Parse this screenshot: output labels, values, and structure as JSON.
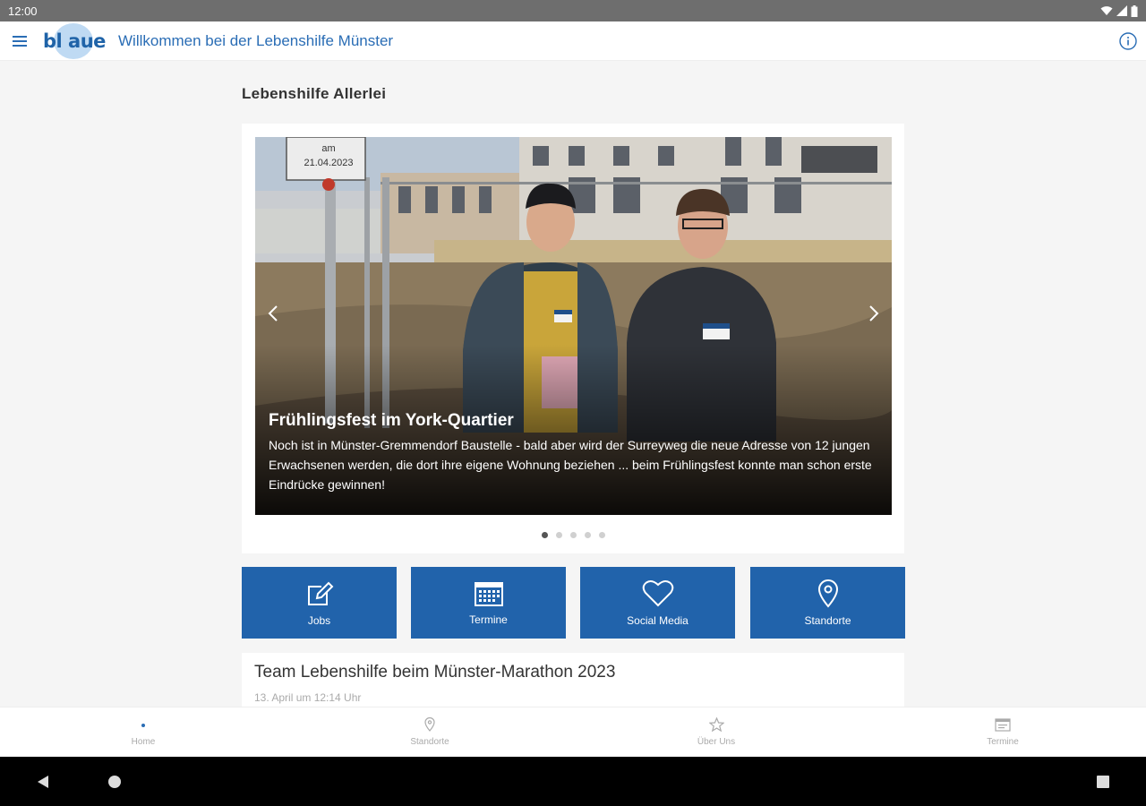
{
  "status_bar": {
    "time": "12:00",
    "icons": [
      "wifi-icon",
      "signal-icon",
      "battery-icon"
    ]
  },
  "app_bar": {
    "logo_text": "bl aue",
    "title": "Willkommen bei der Lebenshilfe Münster",
    "menu_icon": "hamburger-menu-icon",
    "info_icon": "info-icon"
  },
  "section": {
    "title": "Lebenshilfe Allerlei"
  },
  "carousel": {
    "slide_title": "Frühlingsfest im York-Quartier",
    "slide_text": "Noch ist in Münster-Gremmendorf Baustelle - bald aber wird der Surreyweg die neue Adresse von 12 jungen Erwachsenen werden, die dort ihre eigene Wohnung beziehen ... beim Frühlingsfest konnte man schon erste Eindrücke gewinnen!",
    "sign_text": [
      "am",
      "21.04.2023"
    ],
    "slide_count": 5,
    "active_index": 0
  },
  "tiles": [
    {
      "label": "Jobs",
      "icon": "edit-icon"
    },
    {
      "label": "Termine",
      "icon": "calendar-icon"
    },
    {
      "label": "Social Media",
      "icon": "heart-icon"
    },
    {
      "label": "Standorte",
      "icon": "location-pin-icon"
    }
  ],
  "article": {
    "title": "Team Lebenshilfe beim Münster-Marathon 2023",
    "date": "13. April um 12:14 Uhr"
  },
  "bottom_nav": [
    {
      "label": "Home",
      "icon": "home-icon",
      "active": true
    },
    {
      "label": "Standorte",
      "icon": "location-pin-icon",
      "active": false
    },
    {
      "label": "Über Uns",
      "icon": "star-icon",
      "active": false
    },
    {
      "label": "Termine",
      "icon": "calendar-icon",
      "active": false
    }
  ],
  "colors": {
    "brand_blue": "#2163ab",
    "title_blue": "#2a6db5",
    "logo_bubble": "#bfdaf3"
  }
}
